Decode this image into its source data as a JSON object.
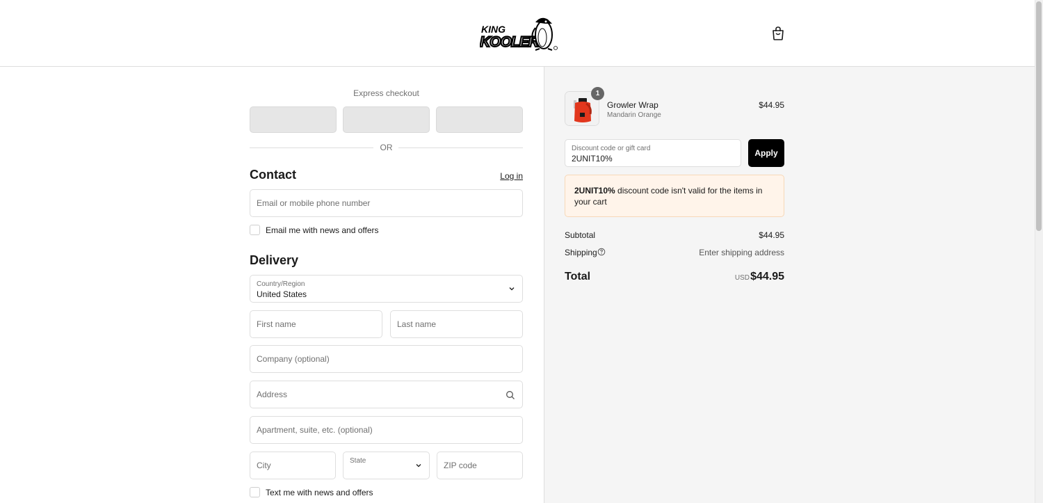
{
  "header": {
    "logo_alt": "KING KOOLER",
    "logo_word_top": "KING",
    "logo_word_bottom": "KOOLER"
  },
  "express": {
    "label": "Express checkout",
    "or_label": "OR"
  },
  "contact": {
    "heading": "Contact",
    "login_link": "Log in",
    "email_placeholder": "Email or mobile phone number",
    "email_optin": "Email me with news and offers"
  },
  "delivery": {
    "heading": "Delivery",
    "country_label": "Country/Region",
    "country_value": "United States",
    "first_name_placeholder": "First name",
    "last_name_placeholder": "Last name",
    "company_placeholder": "Company (optional)",
    "address_placeholder": "Address",
    "apartment_placeholder": "Apartment, suite, etc. (optional)",
    "city_placeholder": "City",
    "state_label": "State",
    "zip_placeholder": "ZIP code",
    "sms_optin": "Text me with news and offers"
  },
  "summary": {
    "item": {
      "quantity": "1",
      "name": "Growler Wrap",
      "variant": "Mandarin Orange",
      "price": "$44.95"
    },
    "discount": {
      "label": "Discount code or gift card",
      "value": "2UNIT10%",
      "apply_label": "Apply",
      "error_code": "2UNIT10%",
      "error_text": " discount code isn't valid for the items in your cart"
    },
    "subtotal_label": "Subtotal",
    "subtotal_value": "$44.95",
    "shipping_label": "Shipping",
    "shipping_value": "Enter shipping address",
    "total_label": "Total",
    "total_currency": "USD",
    "total_value": "$44.95"
  },
  "colors": {
    "accent": "#000000",
    "error_bg": "#fff4ea",
    "summary_bg": "#f5f5f5",
    "product_orange": "#e2371d"
  },
  "icons": [
    "shopping-bag-icon",
    "chevron-down-icon",
    "search-icon",
    "help-circle-icon"
  ]
}
